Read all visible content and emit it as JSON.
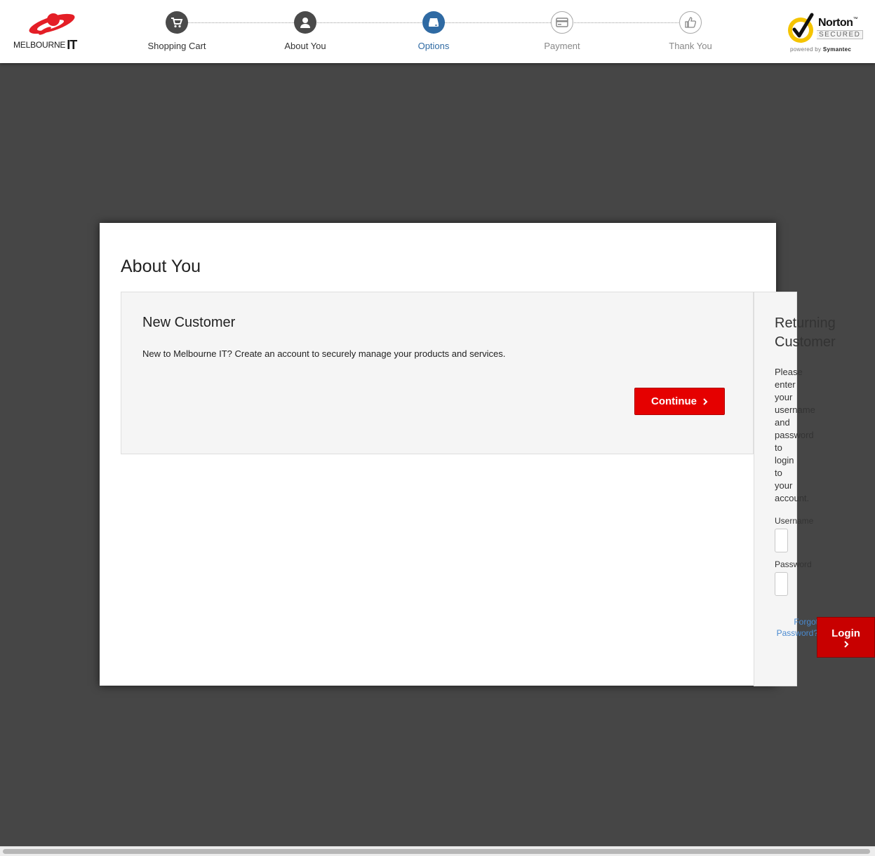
{
  "brand": {
    "name_small": "MELBOURNE",
    "name_big": "IT",
    "accent_color": "#e41e26"
  },
  "steps": [
    {
      "label": "Shopping Cart",
      "icon": "cart-icon",
      "state": "done"
    },
    {
      "label": "About You",
      "icon": "user-icon",
      "state": "done"
    },
    {
      "label": "Options",
      "icon": "hard-drive-icon",
      "state": "active"
    },
    {
      "label": "Payment",
      "icon": "credit-card-icon",
      "state": "todo"
    },
    {
      "label": "Thank You",
      "icon": "thumbs-up-icon",
      "state": "todo"
    }
  ],
  "norton": {
    "name": "Norton",
    "tm": "™",
    "secured": "SECURED",
    "powered_prefix": "powered by",
    "powered_brand": "Symantec"
  },
  "modal": {
    "title": "About You",
    "new_customer": {
      "title": "New Customer",
      "description": "New to Melbourne IT? Create an account to securely manage your products and services.",
      "continue_label": "Continue"
    },
    "returning_customer": {
      "title_line1": "Returning",
      "title_line2": "Customer",
      "description_words": [
        "Please",
        "enter",
        "your",
        "username",
        "and",
        "password",
        "to",
        "login",
        "to",
        "your",
        "account."
      ],
      "username_label": "Username",
      "password_label": "Password",
      "forgot_label": "Forgot Password?",
      "login_label": "Login"
    }
  },
  "colors": {
    "background": "#464646",
    "active_step": "#2f6aa3",
    "button_red": "#e50000",
    "link_blue": "#4a8ad0"
  }
}
